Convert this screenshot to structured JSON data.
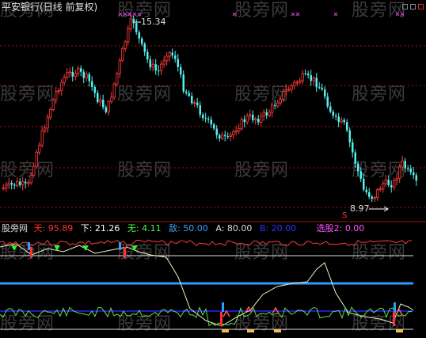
{
  "header": {
    "title": "平安银行(日线 前复权)"
  },
  "window_buttons": [
    "minimize-icon",
    "maximize-icon",
    "close-icon"
  ],
  "watermark": "股旁网",
  "price_panel": {
    "high_label": "15.34",
    "low_label": "8.97",
    "marker_label": "S"
  },
  "indicator_bar": {
    "name": "股旁网",
    "items": [
      {
        "key": "天",
        "value": "95.89",
        "color": "#ff3333"
      },
      {
        "key": "下",
        "value": "21.26",
        "color": "#ffffff"
      },
      {
        "key": "无",
        "value": "4.11",
        "color": "#44ff44"
      },
      {
        "key": "敌",
        "value": "50.00",
        "color": "#3f9fff"
      },
      {
        "key": "A",
        "value": "80.00",
        "color": "#dddddd"
      },
      {
        "key": "B",
        "value": "20.00",
        "color": "#3333ff"
      },
      {
        "key": "选股2",
        "value": "0.00",
        "color": "#ff55ff"
      }
    ]
  },
  "colors": {
    "up": "#ff3b3b",
    "down": "#54f0f0",
    "grid": "#a01010",
    "level_line": "#2f9cff"
  }
}
